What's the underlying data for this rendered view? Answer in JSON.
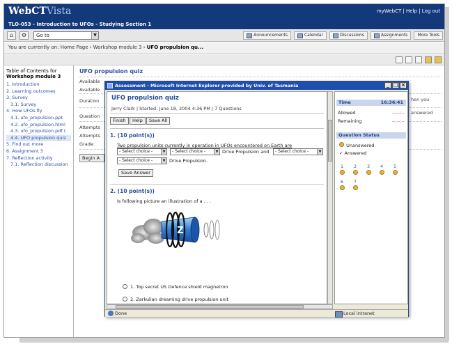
{
  "header": {
    "logo_main": "WebCT",
    "logo_sub": "Vista",
    "top_links": "myWebCT | Help | Log out",
    "course_title": "TLO-053 - Introduction to UFOs - Studying Section 1"
  },
  "toolbar": {
    "goto_value": "Go to",
    "tabs": [
      "Announcements",
      "Calendar",
      "Discussions",
      "Assignments",
      "More Tools"
    ]
  },
  "breadcrumb": {
    "prefix": "You are currently on: Home Page › Workshop module 3 ›",
    "current": "UFO propulsion qu..."
  },
  "toc": {
    "title_line1": "Table of Contents for",
    "title_line2": "Workshop module 3",
    "items": [
      "1. Introduction",
      "2. Learning outcomes",
      "3. Survey",
      "3.1. Survey",
      "4. How UFOs fly",
      "4.1. ufo_propulsion.ppt",
      "4.2. ufo_propulsion.html",
      "4.3. ufo_propulsion.pdf (",
      "4.4. UFO propulsion quiz",
      "5. Find out more",
      "6. Assignment 3",
      "7. Reflection activity",
      "7.1. Reflection discussion"
    ]
  },
  "main": {
    "title": "UFO propulsion quiz",
    "labels": [
      "Available",
      "Available",
      "Duration",
      "Question",
      "Attempts",
      "Attempts",
      "Grade:"
    ],
    "begin_label": "Begin A",
    "right_text_1": "hen you",
    "right_text_2": "answered"
  },
  "popup": {
    "window_title": "Assessment - Microsoft Internet Explorer provided by Univ. of Tasmania",
    "quiz_title": "UFO propulsion quiz",
    "meta": "Jerry Clark  |  Started: June 18, 2004 4:36 PM  |  7 Questions",
    "buttons": {
      "finish": "Finish",
      "help": "Help",
      "save_all": "Save All"
    },
    "q1": {
      "heading": "1.  (10 point(s))",
      "stem": "Two propulsion units currently in operation in UFOs encountered on Earth are",
      "select_placeholder": "- Select choice -",
      "text_mid": "Drive Propulsion and",
      "text_end": "Drive Propulsion.",
      "save_answer": "Save Answer"
    },
    "q2": {
      "heading": "2.  (10 point(s))",
      "stem": "Is following picture an illustration of a . . .",
      "illustration_letter": "Z",
      "option_1": "1. Top secret US Defence shield magnetron",
      "option_2": "2. Zarkulian dreaming drive propulsion unit"
    },
    "status_done": "Done",
    "status_zone": "Local intranet"
  },
  "sidepanel": {
    "time_label": "Time",
    "time_value": "16:36:41",
    "allowed_label": "Allowed",
    "allowed_value": "--:--:--",
    "remaining_label": "Remaining",
    "remaining_value": "--:--:--",
    "status_heading": "Question Status",
    "unanswered": "Unanswered",
    "answered": "Answered",
    "questions": [
      "1",
      "2",
      "3",
      "4",
      "5",
      "6",
      "7"
    ]
  },
  "colors": {
    "header_bg": "#14397a",
    "titlebar": "#1f4fae",
    "link": "#2b4fa0",
    "unanswered_dot": "#e7b53a"
  }
}
